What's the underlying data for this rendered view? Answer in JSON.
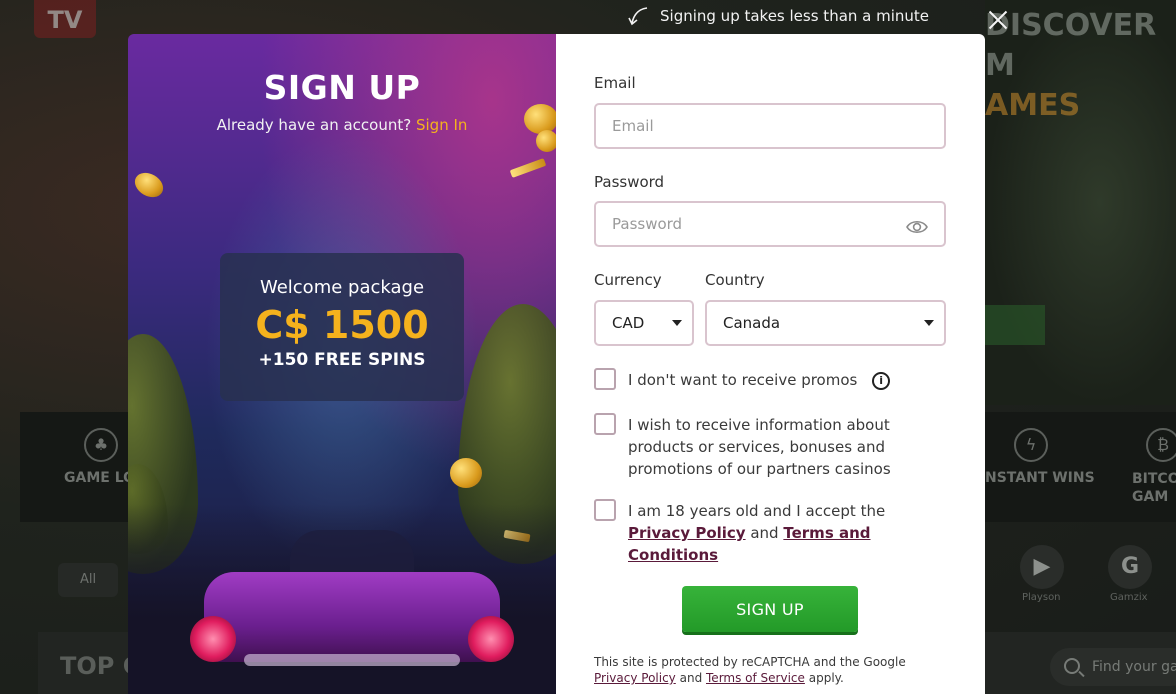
{
  "background": {
    "logo": "TV",
    "hero_texts": [
      "DISCOVER",
      "M",
      "AMES"
    ],
    "categories": [
      "GAME LO",
      "NSTANT WINS",
      "BITCO GAM"
    ],
    "all_pill": "All",
    "providers": [
      {
        "glyph": "▶",
        "label": "Playson"
      },
      {
        "glyph": "G",
        "label": "Gamzix"
      }
    ],
    "top_title": "TOP G",
    "search_placeholder": "Find your ga"
  },
  "hint": {
    "text": "Signing up takes less than a minute"
  },
  "promo": {
    "title": "SIGN UP",
    "account_question": "Already have an account?",
    "signin_link": "Sign In",
    "welcome_label": "Welcome package",
    "welcome_amount": "C$ 1500",
    "welcome_spins": "+150 FREE SPINS"
  },
  "form": {
    "email_label": "Email",
    "email_placeholder": "Email",
    "password_label": "Password",
    "password_placeholder": "Password",
    "currency_label": "Currency",
    "currency_value": "CAD",
    "country_label": "Country",
    "country_value": "Canada",
    "promo_optout": "I don't want to receive promos",
    "partner_info": "I wish to receive information about products or services, bonuses and promotions of our partners casinos",
    "age_prefix": "I am 18 years old and I accept the",
    "privacy_policy": "Privacy Policy",
    "and_word": "and",
    "terms": "Terms and Conditions",
    "submit": "SIGN UP",
    "recaptcha_text": "This site is protected by reCAPTCHA and the Google",
    "recaptcha_privacy": "Privacy Policy",
    "recaptcha_and": "and",
    "recaptcha_terms": "Terms of Service",
    "recaptcha_apply": "apply."
  },
  "colors": {
    "accent_gold": "#f5b21d",
    "button_green": "#2aa52e",
    "link_maroon": "#5a1a3a"
  }
}
